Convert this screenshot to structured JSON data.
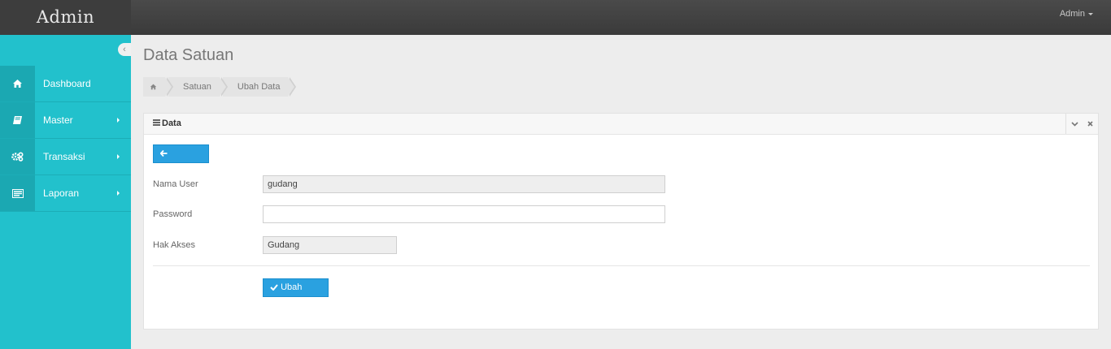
{
  "app": {
    "brand": "Admin",
    "user_menu": "Admin"
  },
  "sidebar": {
    "items": [
      {
        "label": "Dashboard",
        "icon": "home-icon",
        "has_submenu": false
      },
      {
        "label": "Master",
        "icon": "book-icon",
        "has_submenu": true
      },
      {
        "label": "Transaksi",
        "icon": "gears-icon",
        "has_submenu": true
      },
      {
        "label": "Laporan",
        "icon": "list-icon",
        "has_submenu": true
      }
    ]
  },
  "page": {
    "title": "Data Satuan",
    "breadcrumb": [
      "Satuan",
      "Ubah Data"
    ]
  },
  "panel": {
    "title": "Data",
    "back_label": "Kembali",
    "fields": {
      "nama_user_label": "Nama User",
      "nama_user_value": "gudang",
      "password_label": "Password",
      "password_value": "",
      "hak_akses_label": "Hak Akses",
      "hak_akses_value": "Gudang"
    },
    "submit_label": "Ubah Data"
  },
  "colors": {
    "sidebar": "#22c1cc",
    "button": "#2aa1e0",
    "topbar": "#3d3d3d"
  }
}
